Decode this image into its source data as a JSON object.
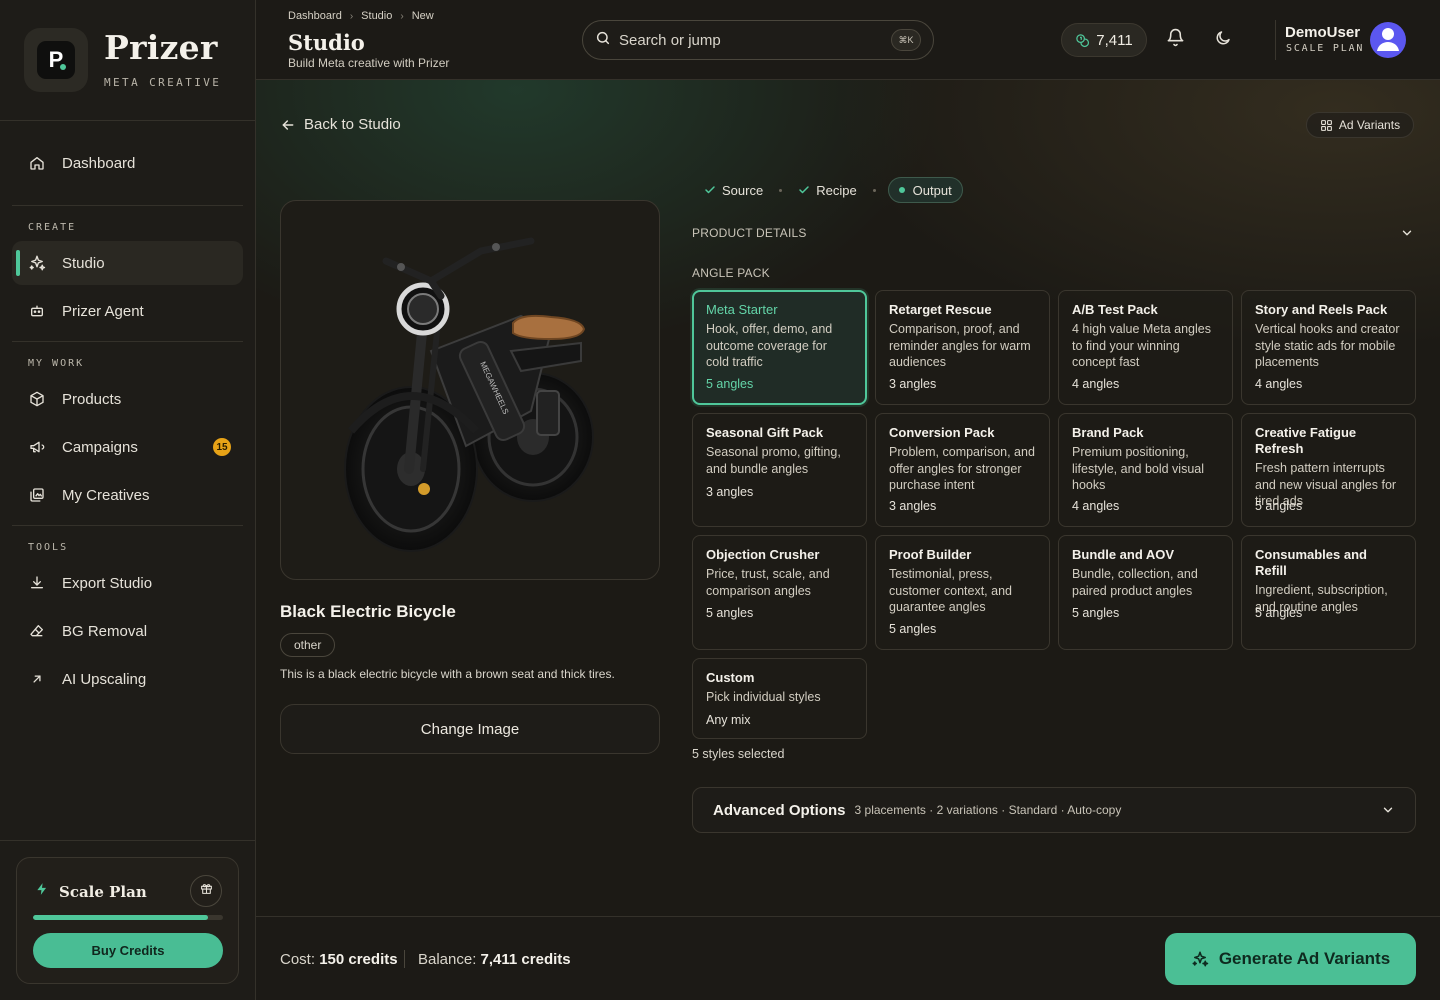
{
  "brand": {
    "name": "Prizer",
    "subtitle": "META CREATIVE",
    "logo_letter": "P"
  },
  "sidebar": {
    "dashboard": "Dashboard",
    "sections": {
      "create": "CREATE",
      "my_work": "MY WORK",
      "tools": "TOOLS"
    },
    "items": {
      "studio": "Studio",
      "agent": "Prizer Agent",
      "products": "Products",
      "campaigns": "Campaigns",
      "campaigns_badge": "15",
      "creatives": "My Creatives",
      "export": "Export Studio",
      "bg_removal": "BG Removal",
      "upscaling": "AI Upscaling"
    },
    "plan": {
      "title": "Scale Plan",
      "usage_fraction": 0.92,
      "buy_label": "Buy Credits"
    }
  },
  "header": {
    "breadcrumb": [
      "Dashboard",
      "Studio",
      "New"
    ],
    "title": "Studio",
    "subtitle": "Build Meta creative with Prizer",
    "search_placeholder": "Search or jump",
    "search_shortcut": "⌘K",
    "credits": "7,411",
    "user_name": "DemoUser",
    "user_plan": "SCALE PLAN"
  },
  "main": {
    "back_label": "Back to Studio",
    "variants_label": "Ad Variants",
    "steps": [
      "Source",
      "Recipe",
      "Output"
    ],
    "product": {
      "title": "Black Electric Bicycle",
      "tag": "other",
      "description": "This is a black electric bicycle with a brown seat and thick tires.",
      "change_image_label": "Change Image",
      "frame_text": "MEGAWHEELS"
    },
    "product_details_label": "PRODUCT DETAILS",
    "angle_pack_label": "ANGLE PACK",
    "packs": [
      {
        "title": "Meta Starter",
        "desc": "Hook, offer, demo, and outcome coverage for cold traffic",
        "count": "5 angles"
      },
      {
        "title": "Retarget Rescue",
        "desc": "Comparison, proof, and reminder angles for warm audiences",
        "count": "3 angles"
      },
      {
        "title": "A/B Test Pack",
        "desc": "4 high value Meta angles to find your winning concept fast",
        "count": "4 angles"
      },
      {
        "title": "Story and Reels Pack",
        "desc": "Vertical hooks and creator style static ads for mobile placements",
        "count": "4 angles"
      },
      {
        "title": "Seasonal Gift Pack",
        "desc": "Seasonal promo, gifting, and bundle angles",
        "count": "3 angles"
      },
      {
        "title": "Conversion Pack",
        "desc": "Problem, comparison, and offer angles for stronger purchase intent",
        "count": "3 angles"
      },
      {
        "title": "Brand Pack",
        "desc": "Premium positioning, lifestyle, and bold visual hooks",
        "count": "4 angles"
      },
      {
        "title": "Creative Fatigue Refresh",
        "desc": "Fresh pattern interrupts and new visual angles for tired ads",
        "count": "5 angles"
      },
      {
        "title": "Objection Crusher",
        "desc": "Price, trust, scale, and comparison angles",
        "count": "5 angles"
      },
      {
        "title": "Proof Builder",
        "desc": "Testimonial, press, customer context, and guarantee angles",
        "count": "5 angles"
      },
      {
        "title": "Bundle and AOV",
        "desc": "Bundle, collection, and paired product angles",
        "count": "5 angles"
      },
      {
        "title": "Consumables and Refill",
        "desc": "Ingredient, subscription, and routine angles",
        "count": "5 angles"
      },
      {
        "title": "Custom",
        "desc": "Pick individual styles",
        "count": "Any mix"
      }
    ],
    "selected_note": "5 styles selected",
    "advanced": {
      "title": "Advanced Options",
      "summary": "3 placements · 2 variations · Standard · Auto-copy"
    }
  },
  "footer": {
    "cost_label": "Cost:",
    "cost_value": "150 credits",
    "balance_label": "Balance:",
    "balance_value": "7,411 credits",
    "generate_label": "Generate Ad Variants"
  },
  "colors": {
    "accent": "#4fc79a",
    "badge": "#e8a317",
    "avatar": "#5b57f0"
  }
}
